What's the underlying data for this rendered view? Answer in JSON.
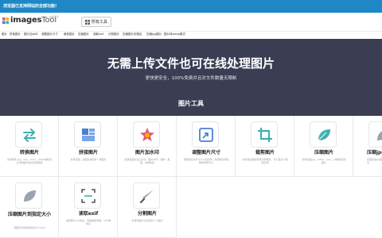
{
  "banner": {
    "text": "浏览器已支持网站的全部功能!"
  },
  "header": {
    "logo_main": "images",
    "logo_tool": "Tool",
    "logo_sub": "在线工具",
    "tools_button": "所有工具"
  },
  "nav": [
    "图片",
    "拼接图片",
    "图片加水印",
    "调整图片尺寸",
    "裁剪图片",
    "压缩图片",
    "读取exif",
    "分割图片",
    "压缩图片到指定",
    "压缩jpg图片",
    "图片转webp格式"
  ],
  "hero": {
    "title": "无需上传文件也可在线处理图片",
    "subtitle": "更快更安全，100%免费并且对文件数量无限制",
    "section_title": "图片工具"
  },
  "tools": [
    {
      "title": "转换图片",
      "desc": "支持转换 jpg、png、bmp、webp等格式之间的图片格式互相转换"
    },
    {
      "title": "拼接图片",
      "desc": "支持长图、多图片拼接成一张图片"
    },
    {
      "title": "图片加水印",
      "desc": "批量给图片加上文字、图片水印，保护、批量、简单快捷"
    },
    {
      "title": "调整图片尺寸",
      "desc": "调整图片的尺寸大小和比例，支持按比例和像素调整尺寸"
    },
    {
      "title": "裁剪图片",
      "desc": "支持自由裁剪和按比例裁剪，可以自定义裁剪区域"
    },
    {
      "title": "压缩图片",
      "desc": "支持压缩jpg、webp、png、gif等格式的图片"
    },
    {
      "title": "压缩jpg并去除exif",
      "desc": "批量压缩jpg图片并去除exif信息"
    },
    {
      "title": "压缩图片到指定大小",
      "desc": "把图片压缩到指定的大小以内"
    },
    {
      "title": "读取exif",
      "desc": "读取图片exif信息，包括拍摄参数、GPS等信息"
    },
    {
      "title": "分割图片",
      "desc": "支持将图片分割成多个小图片"
    }
  ],
  "colors": {
    "banner": "#1e88c7",
    "hero": "#3b3d53",
    "accent_teal": "#3fb0b0",
    "accent_blue": "#4a7fd4",
    "accent_pink": "#e3566f"
  }
}
